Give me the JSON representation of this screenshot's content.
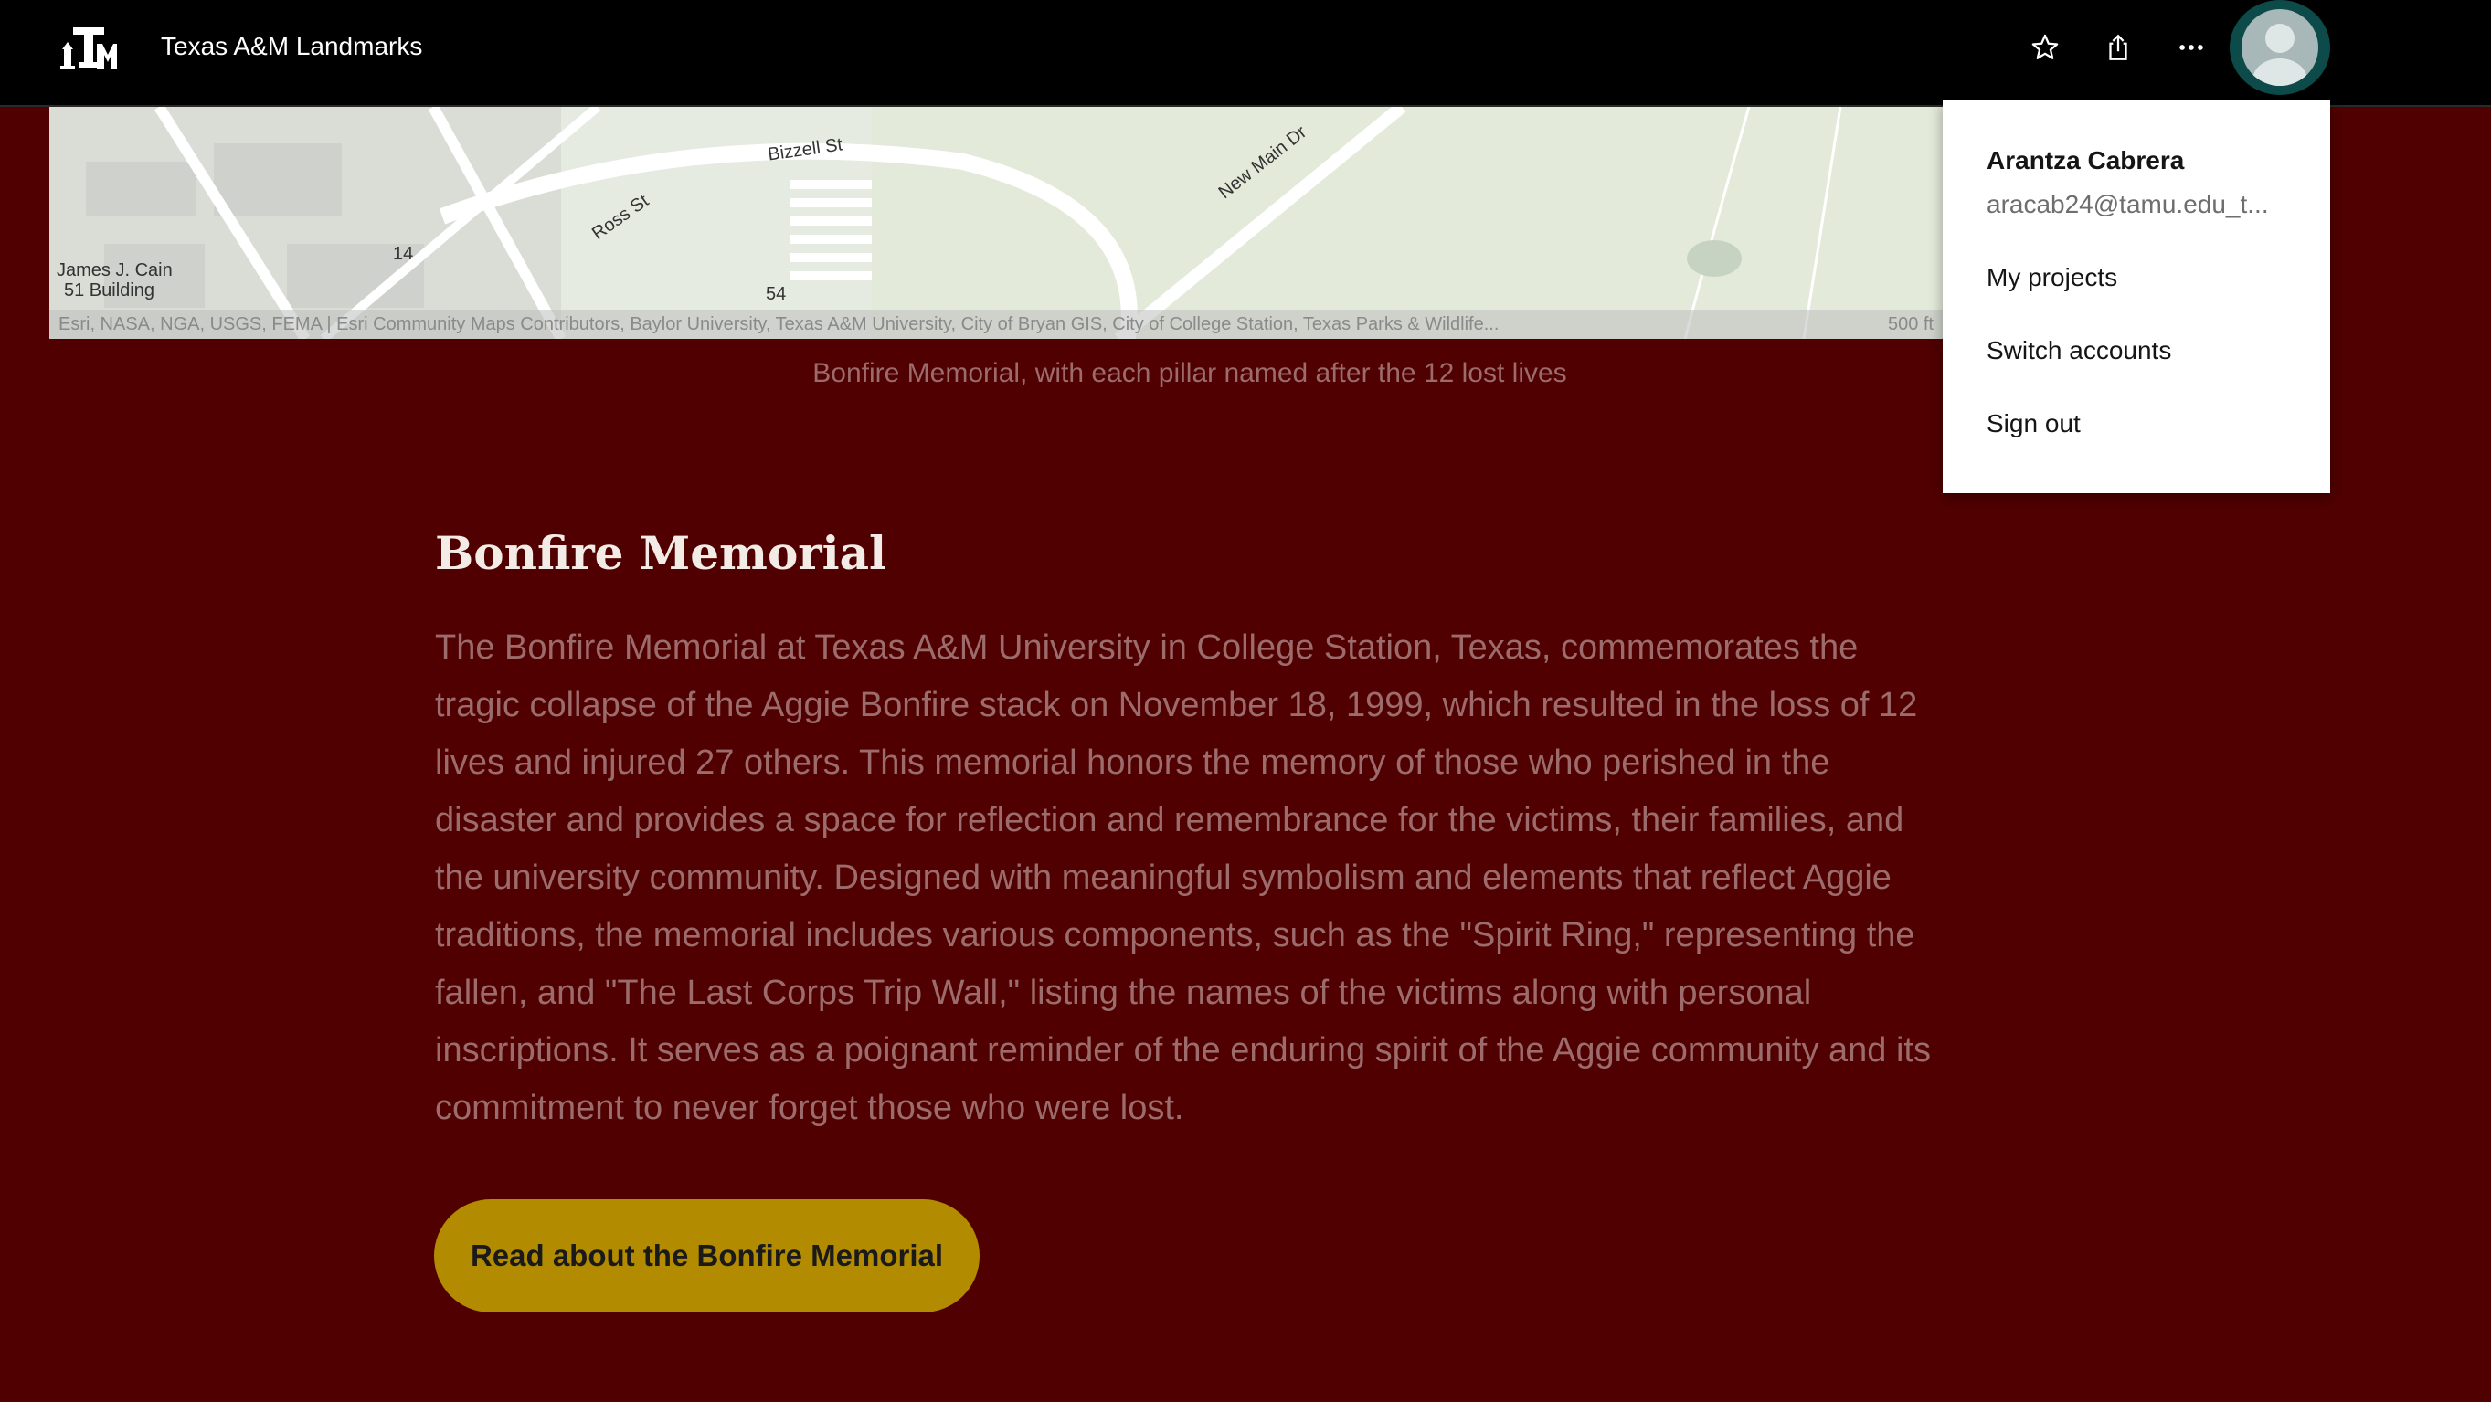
{
  "header": {
    "logo_icon": "texas-am-logo",
    "title": "Texas A&M Landmarks",
    "favorite_icon": "star-icon",
    "share_icon": "share-icon",
    "more_icon": "more-horizontal-icon",
    "avatar_icon": "user-avatar-icon"
  },
  "map": {
    "labels": {
      "bizzell": "Bizzell St",
      "ross": "Ross St",
      "new_main": "New Main Dr",
      "cain_line1": "James J. Cain",
      "cain_line2": "51 Building",
      "num14": "14",
      "num54": "54"
    },
    "attribution": "Esri, NASA, NGA, USGS, FEMA | Esri Community Maps Contributors, Baylor University, Texas A&M University, City of Bryan GIS, City of College Station, Texas Parks & Wildlife...",
    "scale": "500 ft"
  },
  "caption": "Bonfire Memorial, with each pillar named after the 12 lost lives",
  "article": {
    "title": "Bonfire Memorial",
    "body": "The Bonfire Memorial at Texas A&M University in College Station, Texas, commemorates the tragic collapse of the Aggie Bonfire stack on November 18, 1999, which resulted in the loss of 12 lives and injured 27 others. This memorial honors the memory of those who perished in the disaster and provides a space for reflection and remembrance for the victims, their families, and the university community. Designed with meaningful symbolism and elements that reflect Aggie traditions, the memorial includes various components, such as the \"Spirit Ring,\" representing the fallen, and \"The Last Corps Trip Wall,\" listing the names of the victims along with personal inscriptions. It serves as a poignant reminder of the enduring spirit of the Aggie community and its commitment to never forget those who were lost.",
    "button_label": "Read about the Bonfire Memorial"
  },
  "account_menu": {
    "name": "Arantza Cabrera",
    "email": "aracab24@tamu.edu_t...",
    "items": [
      "My projects",
      "Switch accounts",
      "Sign out"
    ]
  },
  "colors": {
    "background": "#500000",
    "button": "#b38b00",
    "avatar_ring": "#0c4b4a"
  }
}
